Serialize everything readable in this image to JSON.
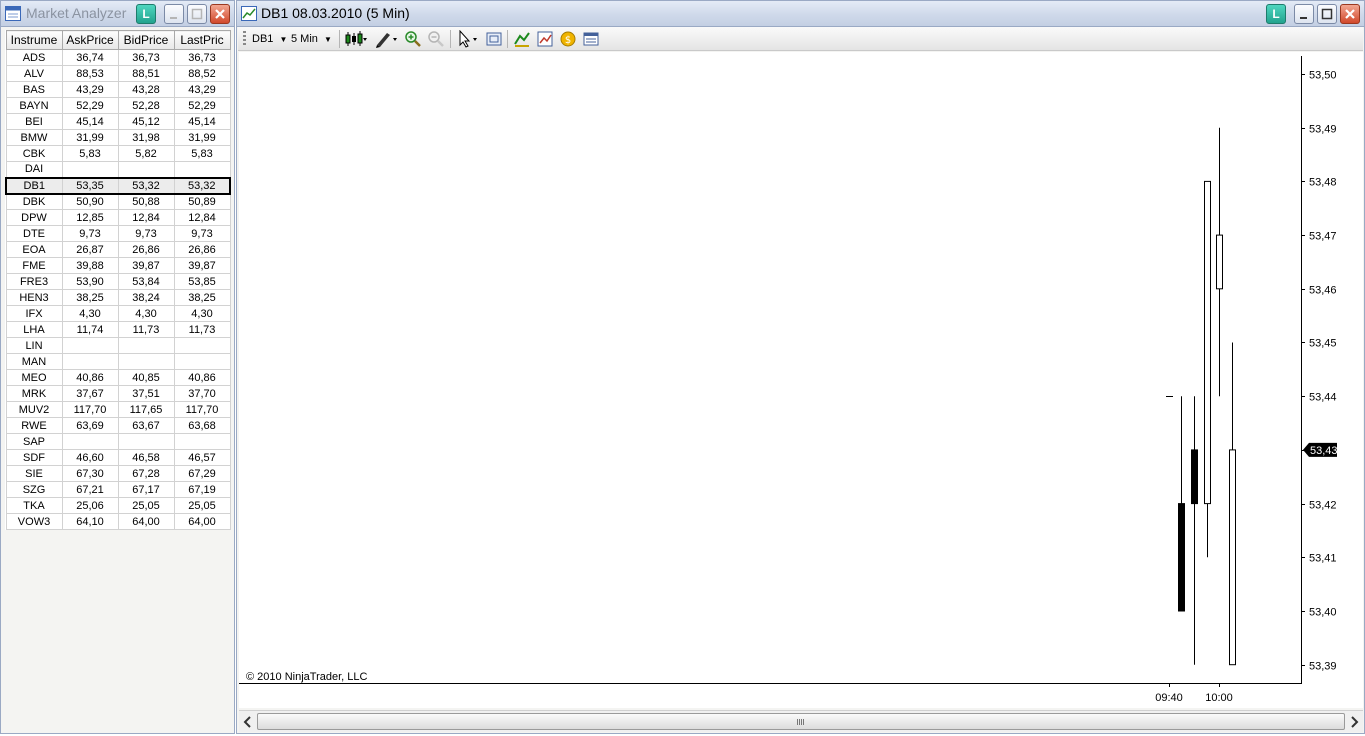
{
  "market_analyzer": {
    "title": "Market Analyzer",
    "link_label": "L",
    "columns": [
      "Instrume",
      "AskPrice",
      "BidPrice",
      "LastPric"
    ],
    "selected_row": "DB1",
    "rows": [
      [
        "ADS",
        "36,74",
        "36,73",
        "36,73"
      ],
      [
        "ALV",
        "88,53",
        "88,51",
        "88,52"
      ],
      [
        "BAS",
        "43,29",
        "43,28",
        "43,29"
      ],
      [
        "BAYN",
        "52,29",
        "52,28",
        "52,29"
      ],
      [
        "BEI",
        "45,14",
        "45,12",
        "45,14"
      ],
      [
        "BMW",
        "31,99",
        "31,98",
        "31,99"
      ],
      [
        "CBK",
        "5,83",
        "5,82",
        "5,83"
      ],
      [
        "DAI",
        "",
        "",
        ""
      ],
      [
        "DB1",
        "53,35",
        "53,32",
        "53,32"
      ],
      [
        "DBK",
        "50,90",
        "50,88",
        "50,89"
      ],
      [
        "DPW",
        "12,85",
        "12,84",
        "12,84"
      ],
      [
        "DTE",
        "9,73",
        "9,73",
        "9,73"
      ],
      [
        "EOA",
        "26,87",
        "26,86",
        "26,86"
      ],
      [
        "FME",
        "39,88",
        "39,87",
        "39,87"
      ],
      [
        "FRE3",
        "53,90",
        "53,84",
        "53,85"
      ],
      [
        "HEN3",
        "38,25",
        "38,24",
        "38,25"
      ],
      [
        "IFX",
        "4,30",
        "4,30",
        "4,30"
      ],
      [
        "LHA",
        "11,74",
        "11,73",
        "11,73"
      ],
      [
        "LIN",
        "",
        "",
        ""
      ],
      [
        "MAN",
        "",
        "",
        ""
      ],
      [
        "MEO",
        "40,86",
        "40,85",
        "40,86"
      ],
      [
        "MRK",
        "37,67",
        "37,51",
        "37,70"
      ],
      [
        "MUV2",
        "117,70",
        "117,65",
        "117,70"
      ],
      [
        "RWE",
        "63,69",
        "63,67",
        "63,68"
      ],
      [
        "SAP",
        "",
        "",
        ""
      ],
      [
        "SDF",
        "46,60",
        "46,58",
        "46,57"
      ],
      [
        "SIE",
        "67,30",
        "67,28",
        "67,29"
      ],
      [
        "SZG",
        "67,21",
        "67,17",
        "67,19"
      ],
      [
        "TKA",
        "25,06",
        "25,05",
        "25,05"
      ],
      [
        "VOW3",
        "64,10",
        "64,00",
        "64,00"
      ]
    ]
  },
  "chart_window": {
    "title": "DB1  08.03.2010 (5 Min)",
    "link_label": "L",
    "toolbar": {
      "instrument": "DB1",
      "interval": "5 Min"
    },
    "copyright": "© 2010 NinjaTrader, LLC"
  },
  "chart_data": {
    "type": "candlestick",
    "instrument": "DB1",
    "interval": "5 Min",
    "y_ticks": [
      "53,50",
      "53,49",
      "53,48",
      "53,47",
      "53,46",
      "53,45",
      "53,44",
      "53,43",
      "53,42",
      "53,41",
      "53,40",
      "53,39"
    ],
    "y_tick_values": [
      53.5,
      53.49,
      53.48,
      53.47,
      53.46,
      53.45,
      53.44,
      53.43,
      53.42,
      53.41,
      53.4,
      53.39
    ],
    "ylim": [
      53.385,
      53.505
    ],
    "x_ticks": [
      "09:40",
      "10:00"
    ],
    "current_price_label": "53,43",
    "current_price": 53.43,
    "last_close_marker": 53.44,
    "candles": [
      {
        "open": 53.42,
        "high": 53.44,
        "low": 53.4,
        "close": 53.4
      },
      {
        "open": 53.43,
        "high": 53.44,
        "low": 53.39,
        "close": 53.42
      },
      {
        "open": 53.42,
        "high": 53.48,
        "low": 53.41,
        "close": 53.48
      },
      {
        "open": 53.46,
        "high": 53.49,
        "low": 53.44,
        "close": 53.47
      },
      {
        "open": 53.39,
        "high": 53.45,
        "low": 53.39,
        "close": 53.43
      }
    ]
  }
}
